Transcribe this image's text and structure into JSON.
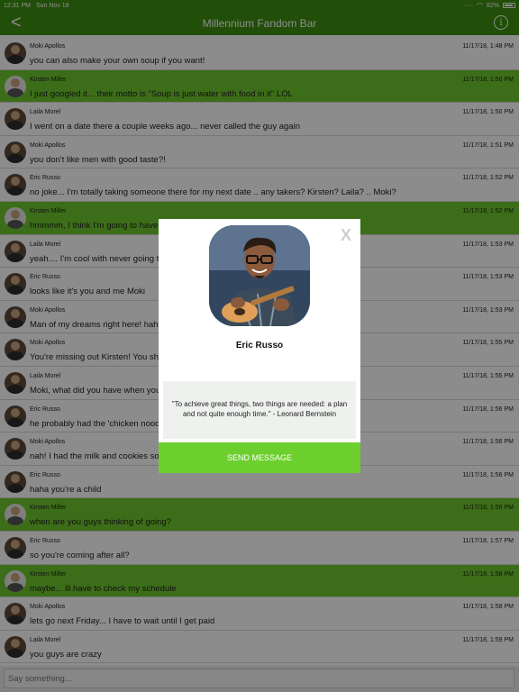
{
  "status": {
    "time": "12:31 PM",
    "date": "Sun Nov 18",
    "battery": "82%"
  },
  "nav": {
    "title": "Millennium Fandom Bar"
  },
  "messages": [
    {
      "name": "Moki Apollos",
      "time": "11/17/18, 1:48 PM",
      "text": "you can also make your own soup if you want!",
      "highlight": false
    },
    {
      "name": "Kirsten Miller",
      "time": "11/17/18, 1:50 PM",
      "text": "I just googled it... their motto is \"Soup is just water with food in it\" LOL",
      "highlight": true
    },
    {
      "name": "Laila Morel",
      "time": "11/17/18, 1:50 PM",
      "text": "I went on a date there a couple weeks ago... never called the guy again",
      "highlight": false
    },
    {
      "name": "Moki Apollos",
      "time": "11/17/18, 1:51 PM",
      "text": "you don't like men with good taste?!",
      "highlight": false
    },
    {
      "name": "Eric Russo",
      "time": "11/17/18, 1:52 PM",
      "text": "no joke... I'm totally taking someone there for my next date .. any takers? Kirsten? Laila? .. Moki?",
      "highlight": false
    },
    {
      "name": "Kirsten Miller",
      "time": "11/17/18, 1:52 PM",
      "text": "hmmmm, I think I'm going to have",
      "highlight": true
    },
    {
      "name": "Laila Morel",
      "time": "11/17/18, 1:53 PM",
      "text": "yeah.... I'm cool with never going t",
      "highlight": false
    },
    {
      "name": "Eric Russo",
      "time": "11/17/18, 1:53 PM",
      "text": "looks like it's you and me Moki",
      "highlight": false
    },
    {
      "name": "Moki Apollos",
      "time": "11/17/18, 1:53 PM",
      "text": "Man of my dreams right here! hah",
      "highlight": false
    },
    {
      "name": "Moki Apollos",
      "time": "11/17/18, 1:55 PM",
      "text": "You're missing out Kirsten! You sh                                                                                           est place I've ever been",
      "highlight": false
    },
    {
      "name": "Laila Morel",
      "time": "11/17/18, 1:55 PM",
      "text": "Moki, what did you have when you",
      "highlight": false
    },
    {
      "name": "Eric Russo",
      "time": "11/17/18, 1:56 PM",
      "text": "he probably had the 'chicken nood",
      "highlight": false
    },
    {
      "name": "Moki Apollos",
      "time": "11/17/18, 1:56 PM",
      "text": "nah! I had the milk and cookies so",
      "highlight": false
    },
    {
      "name": "Eric Russo",
      "time": "11/17/18, 1:56 PM",
      "text": "haha you're a child",
      "highlight": false
    },
    {
      "name": "Kirsten Miller",
      "time": "11/17/18, 1:56 PM",
      "text": "when are you guys thinking of going?",
      "highlight": true
    },
    {
      "name": "Eric Russo",
      "time": "11/17/18, 1:57 PM",
      "text": "so you're coming after all?",
      "highlight": false
    },
    {
      "name": "Kirsten Miller",
      "time": "11/17/18, 1:58 PM",
      "text": "maybe... ill have to check my schedule",
      "highlight": true
    },
    {
      "name": "Moki Apollos",
      "time": "11/17/18, 1:58 PM",
      "text": "lets go next Friday... I have to wait until I get paid",
      "highlight": false
    },
    {
      "name": "Laila Morel",
      "time": "11/17/18, 1:59 PM",
      "text": "you guys are crazy",
      "highlight": false
    }
  ],
  "compose": {
    "placeholder": "Say something..."
  },
  "modal": {
    "close_label": "X",
    "name": "Eric Russo",
    "quote": "\"To achieve great things, two things are needed: a plan and not quite enough time.\" - Leonard Bernstein",
    "send_label": "SEND MESSAGE"
  },
  "colors": {
    "brand": "#3c8f0f",
    "highlight": "#6ec62d",
    "send_button": "#6ccf2e"
  },
  "icons": {
    "back": "chevron-left-icon",
    "info": "info-icon",
    "close": "close-icon"
  }
}
